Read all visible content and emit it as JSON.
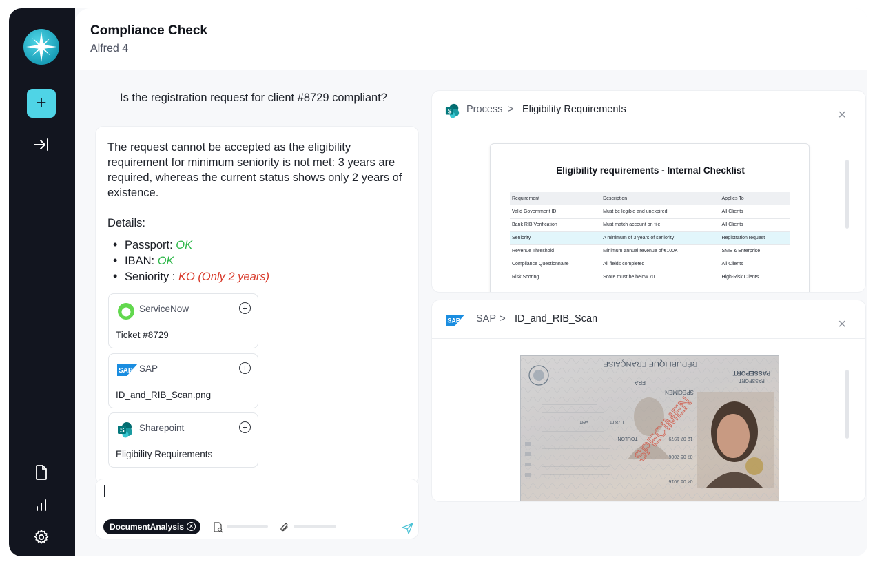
{
  "header": {
    "title": "Compliance Check",
    "subtitle": "Alfred 4"
  },
  "sidebar": {
    "new_label": "+",
    "icons": [
      "app-logo-icon",
      "plus-icon",
      "collapse-arrow-icon",
      "document-icon",
      "bar-chart-icon",
      "gear-icon"
    ]
  },
  "chat": {
    "question": "Is the registration request for client #8729 compliant?",
    "answer_intro": "The request cannot be accepted as the eligibility requirement for minimum seniority is not met: 3 years are required, whereas the current status shows only 2 years of existence.",
    "details_label": "Details:",
    "details": [
      {
        "label": "Passport: ",
        "status": "OK",
        "kind": "ok"
      },
      {
        "label": "IBAN: ",
        "status": "OK",
        "kind": "ok"
      },
      {
        "label": "Seniority : ",
        "status": "KO (Only 2 years)",
        "kind": "ko"
      }
    ],
    "sources": [
      {
        "name": "ServiceNow",
        "doc": "Ticket #8729"
      },
      {
        "name": "SAP",
        "doc": "ID_and_RIB_Scan.png"
      },
      {
        "name": "Sharepoint",
        "doc": "Eligibility Requirements"
      }
    ]
  },
  "composer": {
    "tool_pill": "DocumentAnalysis"
  },
  "panels": {
    "process": {
      "crumb_a": "Process",
      "crumb_sep": ">",
      "crumb_b": "Eligibility Requirements",
      "close": "×",
      "doc_title": "Eligibility requirements - Internal Checklist",
      "columns": [
        "Requirement",
        "Description",
        "Applies To"
      ],
      "rows": [
        [
          "Valid Government ID",
          "Must be legible and unexpired",
          "All Clients"
        ],
        [
          "Bank RIB Verification",
          "Must match account on file",
          "All Clients"
        ],
        [
          "Seniority",
          "A minimum of 3 years of seniority",
          "Registration request"
        ],
        [
          "Revenue Threshold",
          "Minimum annual revenue of €100K",
          "SME & Enterprise"
        ],
        [
          "Compliance Questionnaire",
          "All fields completed",
          "All Clients"
        ],
        [
          "Risk Scoring",
          "Score must be below 70",
          "High-Risk Clients"
        ]
      ],
      "highlight_row": 2
    },
    "sap": {
      "crumb_a": "SAP",
      "crumb_sep": ">",
      "crumb_b": "ID_and_RIB_Scan",
      "close": "×"
    }
  },
  "passport_image": {
    "header_text": "RÉPUBLIQUE FRANÇAISE",
    "passport_label": "PASSEPORT",
    "passport_sub": "PASSPORT",
    "country": "FRA",
    "surname": "SPECIMEN",
    "place": "TOULON",
    "height": "1,78 m",
    "eyes": "Vert",
    "date_1": "12 07 1979",
    "date_2": "07 05 2006",
    "date_3": "04 05 2016",
    "stamp": "SPECIMEN"
  },
  "colors": {
    "sidebar_bg": "#12151f",
    "accent": "#4fd4e6",
    "ok": "#2fb84a",
    "ko": "#d83a2b"
  }
}
